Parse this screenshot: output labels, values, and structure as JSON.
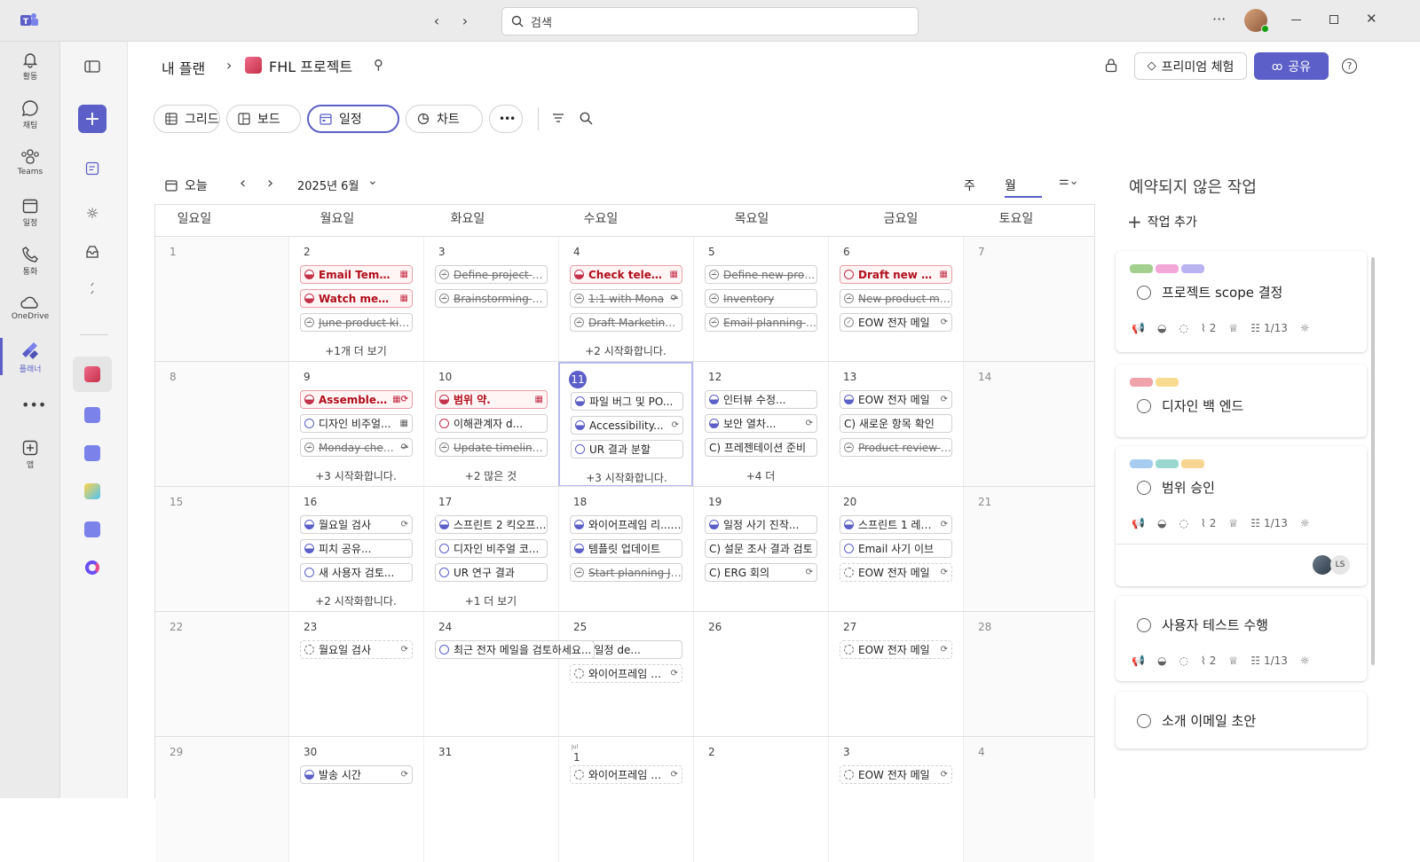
{
  "topbar": {
    "search_placeholder": "검색"
  },
  "rail": [
    {
      "label": "활동",
      "icon": "bell-icon"
    },
    {
      "label": "채팅",
      "icon": "chat-icon"
    },
    {
      "label": "Teams",
      "icon": "teams-icon"
    },
    {
      "label": "일정",
      "icon": "calendar-icon"
    },
    {
      "label": "통화",
      "icon": "phone-icon"
    },
    {
      "label": "OneDrive",
      "icon": "cloud-icon"
    },
    {
      "label": "플래너",
      "icon": "planner-icon"
    },
    {
      "label": "앱",
      "icon": "add-app-icon"
    }
  ],
  "header": {
    "crumb_root": "내 플랜",
    "crumb_project": "FHL 프로젝트",
    "premium": "프리미엄 체험",
    "share": "공유"
  },
  "views": {
    "grid": "그리드",
    "board": "보드",
    "schedule": "일정",
    "chart": "차트"
  },
  "calbar": {
    "today": "오늘",
    "month": "2025년 6월",
    "week": "주",
    "monthview": "월"
  },
  "days": [
    "일요일",
    "월요일",
    "화요일",
    "수요일",
    "목요일",
    "금요일",
    "토요일"
  ],
  "weeks": [
    {
      "dates": [
        "1",
        "2",
        "3",
        "4",
        "5",
        "6",
        "7"
      ],
      "tasks": [
        [],
        [
          {
            "t": "Email Template",
            "s": "red",
            "c": "redh",
            "i": "cal"
          },
          {
            "t": "Watch meeti...",
            "s": "red",
            "c": "redh",
            "i": "cal"
          },
          {
            "t": "June product kic...",
            "s": "done",
            "c": "chk"
          }
        ],
        [
          {
            "t": "Define project str...",
            "s": "done",
            "c": "chk"
          },
          {
            "t": "Brainstorming se...",
            "s": "done",
            "c": "chk"
          }
        ],
        [
          {
            "t": "Check teleme...",
            "s": "red",
            "c": "redh",
            "i": "cal"
          },
          {
            "t": "1:1 with Mona",
            "s": "done",
            "c": "chk",
            "i": "rep"
          },
          {
            "t": "Draft Marketing...",
            "s": "done",
            "c": "chk"
          }
        ],
        [
          {
            "t": "Define new proje...",
            "s": "done",
            "c": "chk"
          },
          {
            "t": "Inventory",
            "s": "done",
            "c": "chk"
          },
          {
            "t": "Email planning te...",
            "s": "done",
            "c": "chk"
          }
        ],
        [
          {
            "t": "Draft new set...",
            "s": "red",
            "c": "redo",
            "i": "cal"
          },
          {
            "t": "New product ma...",
            "s": "done",
            "c": "chk"
          },
          {
            "t": "EOW 전자 메일",
            "s": "",
            "c": "chk",
            "i": "rep"
          }
        ],
        []
      ],
      "more": [
        "",
        "+1개 더 보기",
        "",
        "+2 시작화합니다.",
        "",
        "",
        ""
      ]
    },
    {
      "dates": [
        "8",
        "9",
        "10",
        "11",
        "12",
        "13",
        "14"
      ],
      "tasks": [
        [],
        [
          {
            "t": "Assemble...",
            "s": "red",
            "c": "redh",
            "i": "calrep"
          },
          {
            "t": "디자인 비주얼...",
            "s": "",
            "c": "",
            "i": "cal"
          },
          {
            "t": "Monday chec...",
            "s": "done",
            "c": "chk",
            "i": "rep"
          }
        ],
        [
          {
            "t": "범위 약.",
            "s": "red",
            "c": "redh",
            "i": "cal"
          },
          {
            "t": "이해관계자 d...",
            "s": "",
            "c": "redo"
          },
          {
            "t": "Update timelines...",
            "s": "done",
            "c": "chk"
          }
        ],
        [
          {
            "t": "파일 버그 및 PO...",
            "s": "",
            "c": "half"
          },
          {
            "t": "Accessibility...",
            "s": "",
            "c": "half",
            "i": "rep"
          },
          {
            "t": "UR 결과 분할",
            "s": "",
            "c": ""
          }
        ],
        [
          {
            "t": "인터뷰 수정...",
            "s": "",
            "c": "half"
          },
          {
            "t": "보안 열차...",
            "s": "",
            "c": "half",
            "i": "rep"
          },
          {
            "t": "C) 프레젠테이션 준비",
            "s": "",
            "c": "none"
          }
        ],
        [
          {
            "t": "EOW 전자 메일",
            "s": "",
            "c": "half",
            "i": "rep"
          },
          {
            "t": "C) 새로운 항목 확인",
            "s": "",
            "c": "none"
          },
          {
            "t": "Product review d...",
            "s": "done",
            "c": "chk"
          }
        ],
        []
      ],
      "more": [
        "",
        "+3 시작화합니다.",
        "+2 많은 것",
        "+3 시작화합니다.",
        "+4 더",
        "",
        ""
      ]
    },
    {
      "dates": [
        "15",
        "16",
        "17",
        "18",
        "19",
        "20",
        "21"
      ],
      "tasks": [
        [],
        [
          {
            "t": "월요일 검사",
            "s": "",
            "c": "half",
            "i": "rep"
          },
          {
            "t": "피치 공유...",
            "s": "",
            "c": "half"
          },
          {
            "t": "새 사용자 검토...",
            "s": "",
            "c": ""
          }
        ],
        [
          {
            "t": "스프린트 2 킥오프 (...",
            "s": "",
            "c": "half"
          },
          {
            "t": "디자인 비주얼 코...",
            "s": "",
            "c": ""
          },
          {
            "t": "UR 연구 결과",
            "s": "",
            "c": ""
          }
        ],
        [
          {
            "t": "와이어프레임 리...e.)",
            "s": "",
            "c": "half"
          },
          {
            "t": "템플릿 업데이트",
            "s": "",
            "c": "half"
          },
          {
            "t": "Start planning Jul...",
            "s": "done",
            "c": "chk"
          }
        ],
        [
          {
            "t": "일정 사기 진작...",
            "s": "",
            "c": "half"
          },
          {
            "t": "C) 설문 조사 결과 검토",
            "s": "",
            "c": "none"
          },
          {
            "t": "C) ERG 회의",
            "s": "",
            "c": "none",
            "i": "rep"
          }
        ],
        [
          {
            "t": "스프린트 1 레트로...",
            "s": "",
            "c": "half",
            "i": "rep"
          },
          {
            "t": "Email 사기 이브",
            "s": "",
            "c": ""
          },
          {
            "t": "EOW 전자 메일",
            "s": "dashed",
            "c": "dash",
            "i": "rep"
          }
        ],
        []
      ],
      "more": [
        "",
        "+2 시작화합니다.",
        "+1 더 보기",
        "",
        "",
        "",
        ""
      ]
    },
    {
      "dates": [
        "22",
        "23",
        "24",
        "25",
        "26",
        "27",
        "28"
      ],
      "tasks": [
        [],
        [
          {
            "t": "월요일 검사",
            "s": "dashed",
            "c": "dash",
            "i": "rep"
          }
        ],
        [
          {
            "t": "최근 전자 메일을 검토하세요...",
            "s": "",
            "c": "",
            "wide": true
          }
        ],
        [
          {
            "t": "7월 일정 de...",
            "s": "",
            "c": "none"
          },
          {
            "t": "와이어프레임 리...",
            "s": "dashed",
            "c": "dash",
            "i": "rep"
          }
        ],
        [],
        [
          {
            "t": "EOW 전자 메일",
            "s": "dashed",
            "c": "dash",
            "i": "rep"
          }
        ],
        []
      ],
      "more": [
        "",
        "",
        "",
        "",
        "",
        "",
        ""
      ]
    },
    {
      "dates": [
        "29",
        "30",
        "31",
        "1",
        "2",
        "3",
        "4"
      ],
      "tasks": [
        [],
        [
          {
            "t": "발송 시간",
            "s": "",
            "c": "half",
            "i": "rep"
          }
        ],
        [],
        [
          {
            "t": "와이어프레임 리...",
            "s": "dashed",
            "c": "dash",
            "i": "rep"
          }
        ],
        [],
        [
          {
            "t": "EOW 전자 메일",
            "s": "dashed",
            "c": "dash",
            "i": "rep"
          }
        ],
        []
      ],
      "more": [
        "",
        "",
        "",
        "",
        "",
        "",
        ""
      ]
    }
  ],
  "jul_label": "Jul",
  "right": {
    "title": "예약되지 않은 작업",
    "add": "작업 추가",
    "cards": [
      {
        "labels": [
          "#a3d08f",
          "#f2a7d8",
          "#b9b4f0"
        ],
        "title": "프로젝트 scope 결정",
        "meta": true,
        "attach": "2",
        "check": "1/13"
      },
      {
        "labels": [
          "#f0a3ab",
          "#f7dc8f"
        ],
        "title": "디자인 백 엔드",
        "meta": false
      },
      {
        "labels": [
          "#a6cdef",
          "#9ad8cf",
          "#f7d48f"
        ],
        "title": "범위 승인",
        "meta": true,
        "attach": "2",
        "check": "1/13",
        "avatar": "LS"
      },
      {
        "labels": [],
        "title": "사용자 테스트 수행",
        "meta": true,
        "attach": "2",
        "check": "1/13"
      },
      {
        "labels": [],
        "title": "소개 이메일 초안",
        "meta": false
      }
    ]
  }
}
